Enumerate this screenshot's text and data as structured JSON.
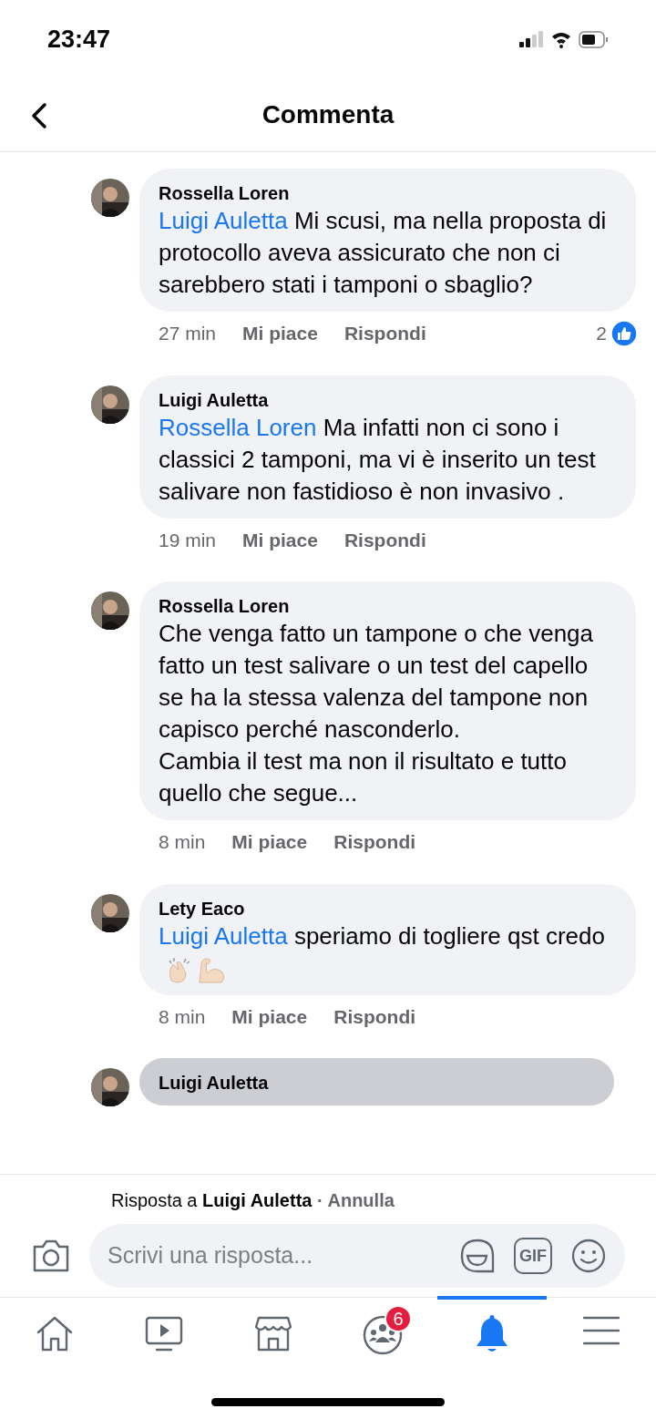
{
  "status_bar": {
    "time": "23:47"
  },
  "header": {
    "title": "Commenta"
  },
  "comments": [
    {
      "author": "Rossella Loren",
      "mention": "Luigi Auletta",
      "text": "Mi scusi, ma nella proposta di protocollo aveva assicurato che non ci sarebbero stati i tamponi o sbaglio?",
      "time": "27 min",
      "like": "Mi piace",
      "reply": "Rispondi",
      "reactions": "2",
      "highlighted": false
    },
    {
      "author": "Luigi Auletta",
      "mention": "Rossella Loren",
      "text": "Ma infatti non ci sono i classici 2 tamponi, ma vi è inserito un test salivare non fastidioso è non invasivo .",
      "time": "19 min",
      "like": "Mi piace",
      "reply": "Rispondi",
      "highlighted": false
    },
    {
      "author": "Rossella Loren",
      "text": "Che venga fatto un tampone o che venga fatto un test salivare o un test del capello se ha la stessa valenza del tampone non capisco perché nasconderlo.\nCambia il test ma non il risultato e tutto quello che segue...",
      "time": "8 min",
      "like": "Mi piace",
      "reply": "Rispondi",
      "highlighted": false
    },
    {
      "author": "Lety Eaco",
      "mention": "Luigi Auletta",
      "text": "speriamo di togliere qst credo",
      "emoji": true,
      "time": "8 min",
      "like": "Mi piace",
      "reply": "Rispondi",
      "highlighted": false
    },
    {
      "author": "Luigi Auletta",
      "highlighted": true
    }
  ],
  "reply_bar": {
    "prefix": "Risposta a",
    "name": "Luigi Auletta",
    "cancel": "· Annulla"
  },
  "composer": {
    "placeholder": "Scrivi una risposta...",
    "gif": "GIF"
  },
  "tabs": [
    {
      "kind": "home",
      "selected": false
    },
    {
      "kind": "video",
      "selected": false
    },
    {
      "kind": "store",
      "selected": false
    },
    {
      "kind": "groups",
      "selected": false,
      "badge": "6"
    },
    {
      "kind": "bell",
      "selected": true
    },
    {
      "kind": "menu",
      "selected": false
    }
  ]
}
